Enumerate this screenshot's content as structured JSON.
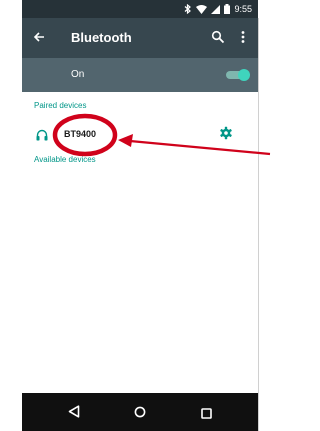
{
  "status_bar": {
    "time": "9:55",
    "icons": [
      "bluetooth-icon",
      "wifi-icon",
      "signal-icon",
      "battery-icon"
    ]
  },
  "app_bar": {
    "title": "Bluetooth",
    "icons": [
      "back-arrow-icon",
      "search-icon",
      "more-vert-icon"
    ]
  },
  "bluetooth_toggle": {
    "label": "On",
    "state": "on"
  },
  "sections": {
    "paired_header": "Paired devices",
    "available_header": "Available devices"
  },
  "paired_devices": [
    {
      "name": "BT9400",
      "icon": "headphones-icon",
      "action_icon": "gear-icon"
    }
  ],
  "nav_bar": {
    "icons": [
      "back-triangle-icon",
      "home-circle-icon",
      "recents-square-icon"
    ]
  },
  "annotation": {
    "type": "red-circle-and-arrow",
    "color": "#d0021b"
  },
  "colors": {
    "status_bar": "#263238",
    "app_bar": "#37474f",
    "toggle_bar": "#52656e",
    "accent": "#009688",
    "nav_bar": "#101010"
  }
}
